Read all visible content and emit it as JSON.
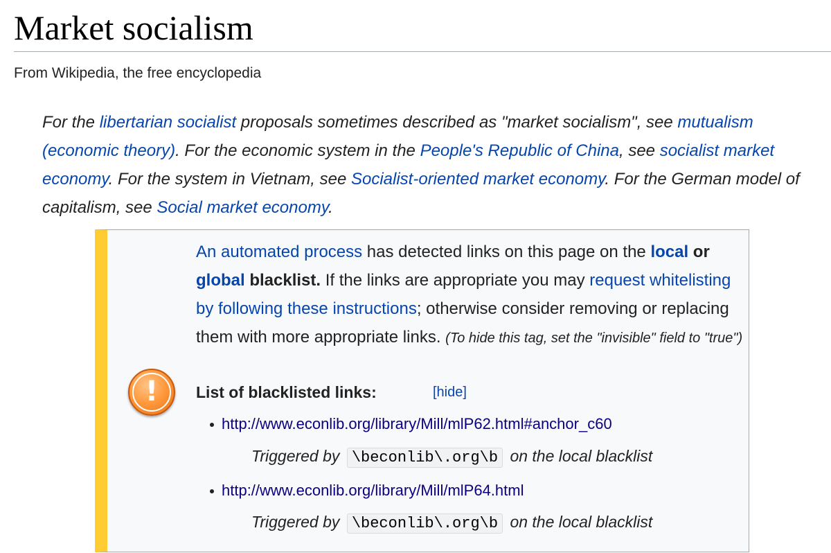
{
  "page": {
    "title": "Market socialism",
    "tagline": "From Wikipedia, the free encyclopedia"
  },
  "hatnote": {
    "t1": "For the ",
    "l1": "libertarian socialist",
    "t2": " proposals sometimes described as \"market socialism\", see ",
    "l2": "mutualism (economic theory)",
    "t3": ". For the economic system in the ",
    "l3": "People's Republic of China",
    "t4": ", see ",
    "l4": "socialist market economy",
    "t5": ". For the system in Vietnam, see ",
    "l5": "Socialist-oriented market economy",
    "t6": ". For the German model of capitalism, see ",
    "l6": "Social market economy",
    "t7": "."
  },
  "ambox": {
    "icon": "warning-exclamation-icon",
    "l_process": "An automated process",
    "t1": " has detected links on this page on the ",
    "l_local": "local",
    "t_or": " or ",
    "l_global": "global",
    "t_blacklist": " blacklist.",
    "t2": " If the links are appropriate you may ",
    "l_request": "request whitelisting by following these instructions",
    "t3": "; otherwise consider removing or replacing them with more appropriate links. ",
    "small": "(To hide this tag, set the \"invisible\" field to \"true\")",
    "list_header": "List of blacklisted links:",
    "hide": "[hide]",
    "links": [
      {
        "url": "http://www.econlib.org/library/Mill/mlP62.html#anchor_c60",
        "trig_pre": "Triggered by",
        "code": "\\beconlib\\.org\\b",
        "trig_post": "on the local blacklist"
      },
      {
        "url": "http://www.econlib.org/library/Mill/mlP64.html",
        "trig_pre": "Triggered by",
        "code": "\\beconlib\\.org\\b",
        "trig_post": "on the local blacklist"
      }
    ]
  },
  "colors": {
    "link": "#0645ad",
    "visited_link": "#0b0080",
    "ambox_stripe": "#ffcc33",
    "ambox_bg": "#f8f9fa",
    "border": "#a2a9b1",
    "icon": "#ff9a3c"
  }
}
